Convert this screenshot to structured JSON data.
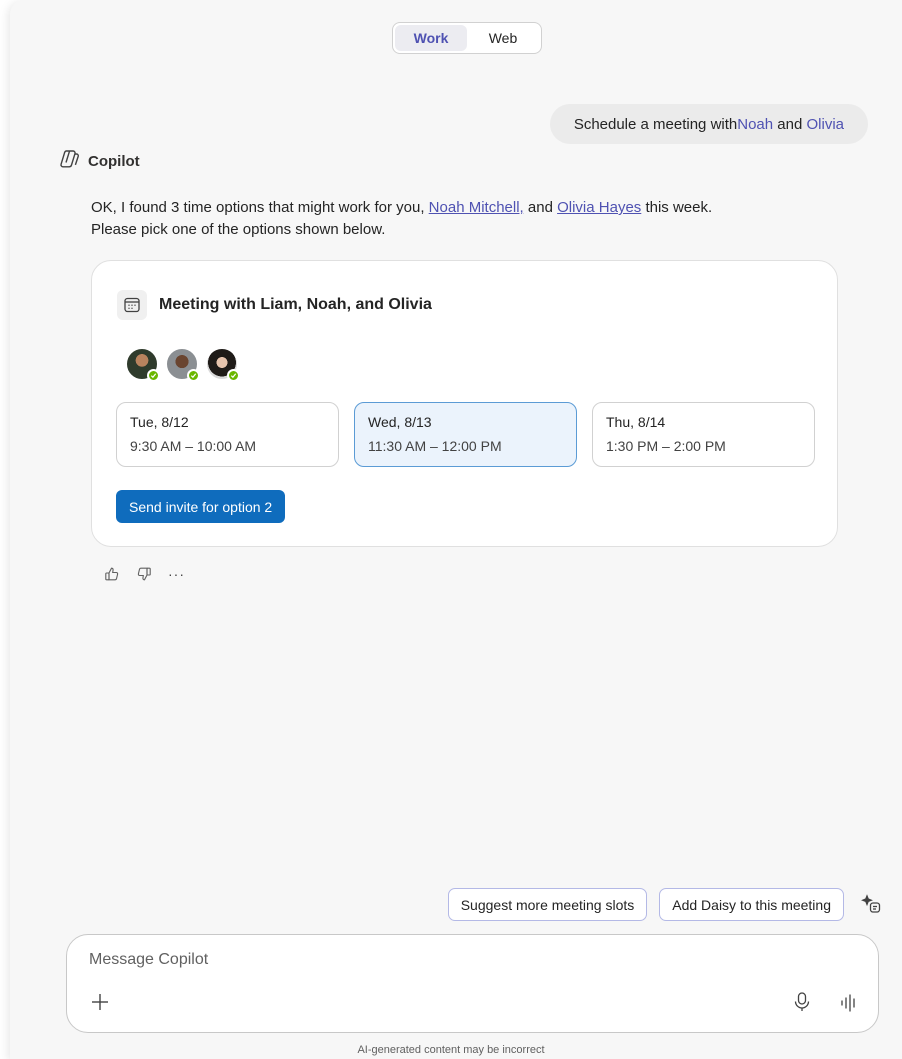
{
  "toggle": {
    "work": "Work",
    "web": "Web"
  },
  "user_message": {
    "prefix": "Schedule a meeting with ",
    "name1": "Noah",
    "middle": " and ",
    "name2": "Olivia"
  },
  "assistant": {
    "name": "Copilot",
    "reply_line1_a": "OK, I found 3 time options that might work for you, ",
    "link1": "Noah Mitchell,",
    "reply_and": " and ",
    "link2": "Olivia Hayes",
    "reply_line1_b": " this week.",
    "reply_line2": "Please pick one of the options shown below."
  },
  "card": {
    "title": "Meeting with Liam, Noah, and Olivia",
    "avatars": [
      {
        "name": "Liam",
        "color": "#3d4a3a"
      },
      {
        "name": "Noah",
        "color": "#5a4a3c"
      },
      {
        "name": "Olivia",
        "color": "#2b2622"
      }
    ],
    "slots": [
      {
        "day": "Tue, 8/12",
        "time": "9:30 AM – 10:00 AM",
        "selected": false
      },
      {
        "day": "Wed, 8/13",
        "time": "11:30 AM – 12:00 PM",
        "selected": true
      },
      {
        "day": "Thu, 8/14",
        "time": "1:30 PM – 2:00 PM",
        "selected": false
      }
    ],
    "send_button": "Send invite for option 2"
  },
  "feedback": {
    "like_icon": "thumbs-up-icon",
    "dislike_icon": "thumbs-down-icon",
    "more": "···"
  },
  "suggestions": [
    "Suggest more meeting slots",
    "Add Daisy to this meeting"
  ],
  "composer": {
    "placeholder": "Message Copilot"
  },
  "disclaimer": "AI-generated content may be incorrect",
  "colors": {
    "accent": "#4f52b2",
    "primary_button": "#0f6cbd",
    "selected_slot": "#ebf3fc",
    "presence": "#6bb700"
  }
}
